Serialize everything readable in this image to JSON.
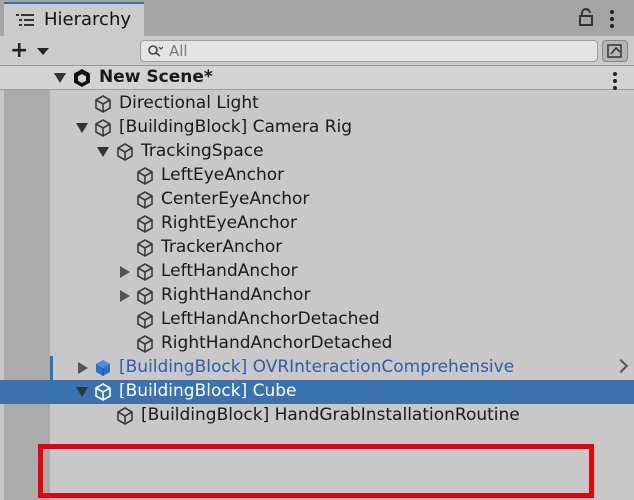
{
  "window": {
    "tab_title": "Hierarchy",
    "tab_icon": "hierarchy-list-icon"
  },
  "toolbar": {
    "add_label": "+",
    "search_placeholder": "All"
  },
  "scene": {
    "name": "New Scene*"
  },
  "items": [
    {
      "label": "Directional Light",
      "depth": 1,
      "expand": "none",
      "icon": "gameobject-cube-icon"
    },
    {
      "label": "[BuildingBlock] Camera Rig",
      "depth": 1,
      "expand": "expanded",
      "icon": "gameobject-cube-icon"
    },
    {
      "label": "TrackingSpace",
      "depth": 2,
      "expand": "expanded",
      "icon": "gameobject-cube-icon"
    },
    {
      "label": "LeftEyeAnchor",
      "depth": 3,
      "expand": "none",
      "icon": "gameobject-cube-icon"
    },
    {
      "label": "CenterEyeAnchor",
      "depth": 3,
      "expand": "none",
      "icon": "gameobject-cube-icon"
    },
    {
      "label": "RightEyeAnchor",
      "depth": 3,
      "expand": "none",
      "icon": "gameobject-cube-icon"
    },
    {
      "label": "TrackerAnchor",
      "depth": 3,
      "expand": "none",
      "icon": "gameobject-cube-icon"
    },
    {
      "label": "LeftHandAnchor",
      "depth": 3,
      "expand": "collapsed",
      "icon": "gameobject-cube-icon"
    },
    {
      "label": "RightHandAnchor",
      "depth": 3,
      "expand": "collapsed",
      "icon": "gameobject-cube-icon"
    },
    {
      "label": "LeftHandAnchorDetached",
      "depth": 3,
      "expand": "none",
      "icon": "gameobject-cube-icon"
    },
    {
      "label": "RightHandAnchorDetached",
      "depth": 3,
      "expand": "none",
      "icon": "gameobject-cube-icon"
    },
    {
      "label": "[BuildingBlock] OVRInteractionComprehensive",
      "depth": 1,
      "expand": "collapsed",
      "icon": "prefab-cube-icon",
      "prefab": true
    },
    {
      "label": "[BuildingBlock] Cube",
      "depth": 1,
      "expand": "expanded",
      "icon": "gameobject-cube-icon",
      "selected": true
    },
    {
      "label": "[BuildingBlock] HandGrabInstallationRoutine",
      "depth": 2,
      "expand": "none",
      "icon": "gameobject-cube-icon"
    }
  ],
  "colors": {
    "selection": "#3a72b0",
    "prefab_text": "#2d5ea8",
    "highlight_box": "#e8000c"
  }
}
